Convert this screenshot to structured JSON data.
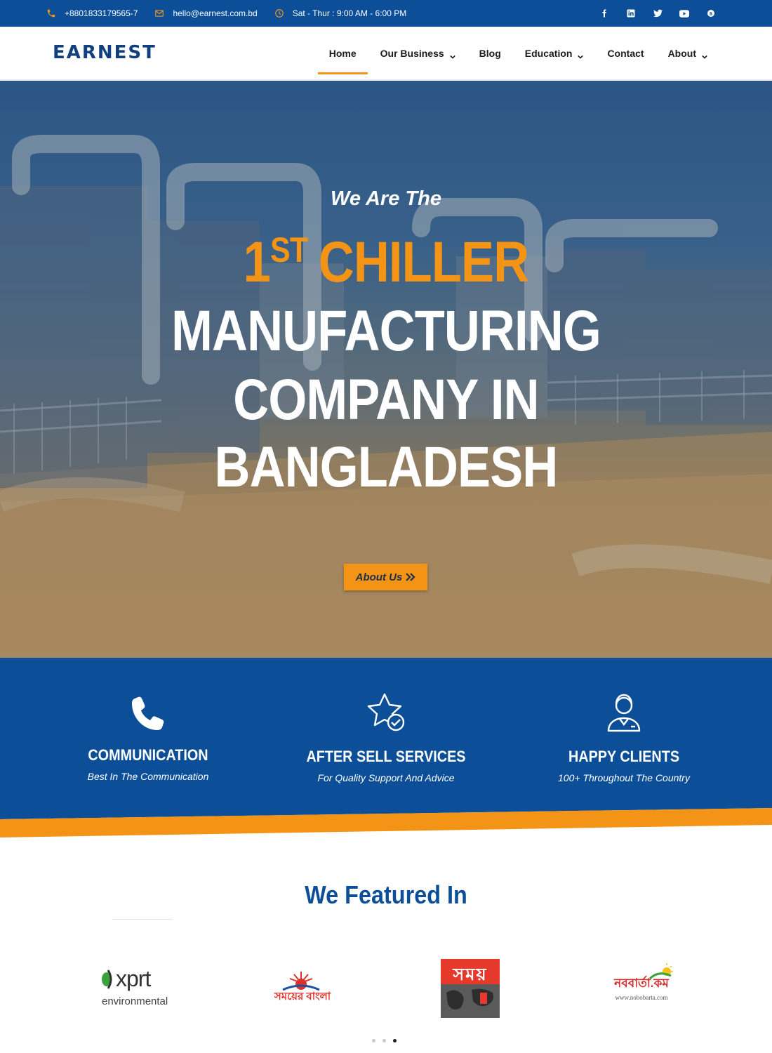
{
  "topbar": {
    "phone": "+8801833179565-7",
    "email": "hello@earnest.com.bd",
    "hours": "Sat - Thur : 9:00 AM - 6:00 PM",
    "social_icons": [
      "facebook-icon",
      "linkedin-icon",
      "twitter-icon",
      "youtube-icon",
      "skype-icon"
    ]
  },
  "header": {
    "logo_text": "EARNEST",
    "nav": [
      {
        "label": "Home",
        "active": true
      },
      {
        "label": "Our Business",
        "dropdown": true
      },
      {
        "label": "Blog"
      },
      {
        "label": "Education",
        "dropdown": true
      },
      {
        "label": "Contact"
      },
      {
        "label": "About",
        "dropdown": true
      }
    ]
  },
  "hero": {
    "pre_title": "We Are The",
    "line1_number": "1",
    "line1_sup": "ST",
    "line1_word": "CHILLER",
    "line2": "MANUFACTURING",
    "line3": "COMPANY IN",
    "line4": "BANGLADESH",
    "button_label": "About Us"
  },
  "features": [
    {
      "icon": "phone-icon",
      "title": "COMMUNICATION",
      "subtitle": "Best In The Communication"
    },
    {
      "icon": "star-check-icon",
      "title": "AFTER SELL SERVICES",
      "subtitle": "For Quality Support And Advice"
    },
    {
      "icon": "support-agent-icon",
      "title": "HAPPY CLIENTS",
      "subtitle": "100+ Throughout The Country"
    }
  ],
  "featured": {
    "title": "We Featured In",
    "logos": [
      {
        "name": "xprt-logo",
        "text_main": "xprt",
        "text_sub": "environmental"
      },
      {
        "name": "somoyer-bangla-logo",
        "text_main": "সময়ের বাংলা"
      },
      {
        "name": "somoy-logo",
        "text_main": "সময়"
      },
      {
        "name": "nobobarta-logo",
        "text_main": "নববার্তা.কম",
        "text_sub": "www.nobobarta.com"
      }
    ],
    "carousel_dots": 3,
    "active_dot": 3
  },
  "colors": {
    "brand_blue": "#0c4f98",
    "accent_orange": "#f39416",
    "logo_navy": "#12407e"
  }
}
